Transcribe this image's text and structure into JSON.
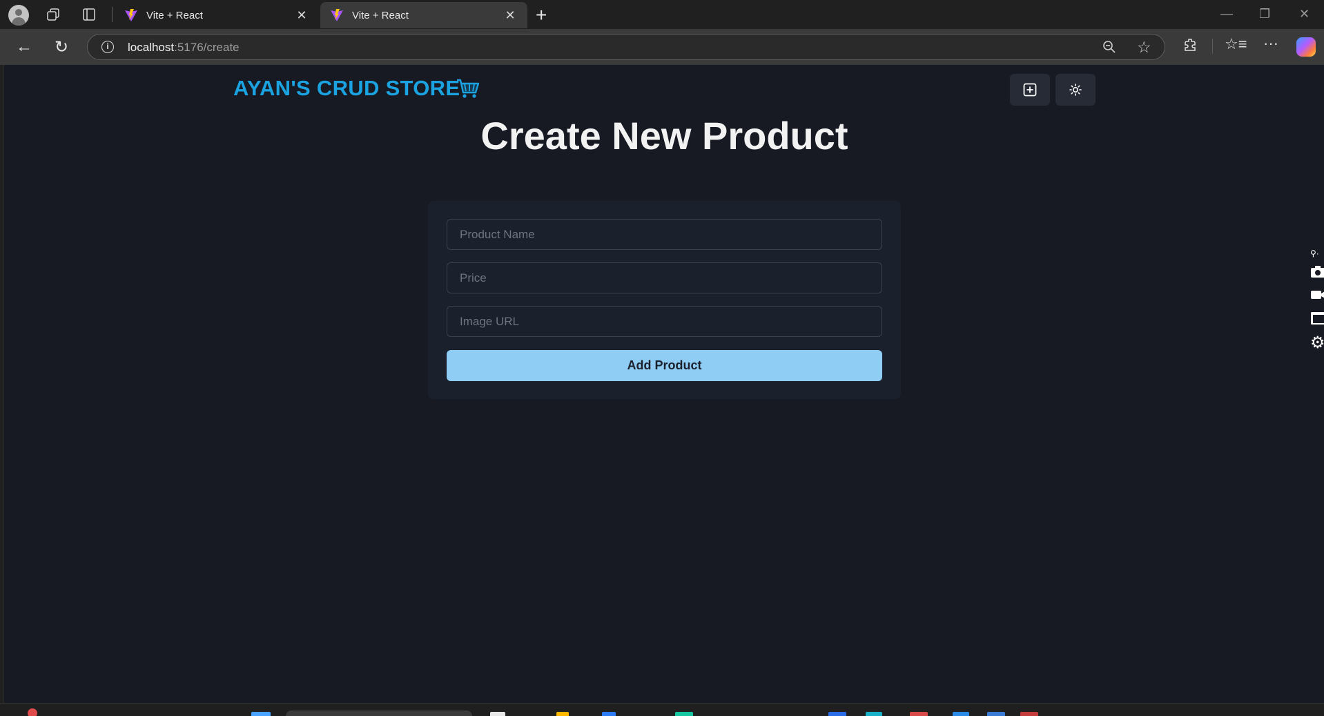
{
  "browser": {
    "tabs": [
      {
        "label": "Vite + React",
        "active": false
      },
      {
        "label": "Vite + React",
        "active": true
      }
    ],
    "url": {
      "host": "localhost",
      "path": ":5176/create"
    }
  },
  "app": {
    "brand": "AYAN'S CRUD STORE",
    "brand_color": "#1aa3e0",
    "header_buttons": [
      "add-square-icon",
      "sun-icon"
    ]
  },
  "page": {
    "title": "Create New Product",
    "form": {
      "name_placeholder": "Product Name",
      "price_placeholder": "Price",
      "image_placeholder": "Image URL",
      "submit_label": "Add Product",
      "submit_color": "#90cdf4"
    }
  }
}
